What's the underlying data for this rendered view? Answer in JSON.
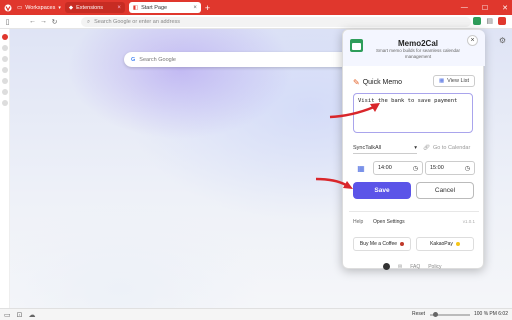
{
  "titlebar": {
    "workspaces_label": "Workspaces",
    "tabs": [
      {
        "label": "Extensions"
      },
      {
        "label": "Start Page"
      }
    ],
    "new_tab": "+",
    "close_glyph": "×"
  },
  "navbar": {
    "address_placeholder": "Search Google or enter an address"
  },
  "page": {
    "search_placeholder": "Search Google"
  },
  "popup": {
    "title": "Memo2Cal",
    "subtitle": "Smart memo builds for seamless calendar management",
    "quick_memo": "Quick Memo",
    "view_list": "View List",
    "memo_text": "Visit the bank to save payment",
    "sync_label": "SyncTalkAll",
    "go_calendar": "Go to Calendar",
    "start_time": "14:00",
    "end_time": "15:00",
    "save": "Save",
    "cancel": "Cancel",
    "help": "Help",
    "open_settings": "Open Settings",
    "version": "v1.0.1",
    "buy_coffee": "Buy Me a Coffee",
    "kakaopay": "KakaoPay",
    "faq": "FAQ",
    "policy": "Policy"
  },
  "statusbar": {
    "reset": "Reset",
    "zoom": "100 %",
    "time": "PM 6:02"
  },
  "colors": {
    "accent": "#5b54e8",
    "titlebar": "#e0372d",
    "arrow": "#d9262b"
  }
}
